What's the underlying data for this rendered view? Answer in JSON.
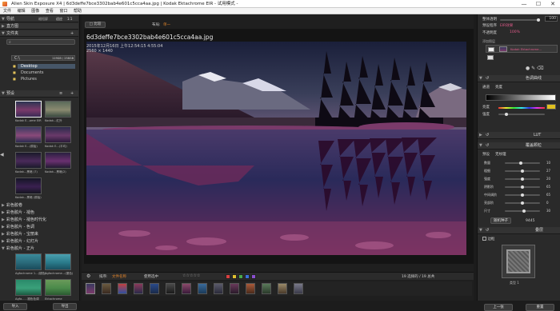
{
  "window": {
    "title": "Alien Skin Exposure X4 | 6d3deffe7bce3302bab4e601c5cca4aa.jpg | Kodak Ektachrome EIR - 试用模式 -",
    "minimize": "—",
    "maximize": "☐",
    "close": "✕"
  },
  "menu": [
    "文件",
    "编辑",
    "图像",
    "查看",
    "窗口",
    "帮助"
  ],
  "left": {
    "nav_label": "导航",
    "zoom_label": "缩短屏",
    "zoom_fit": "适应",
    "zoom_ratio": "1:1",
    "histogram_label": "直方图",
    "folders_label": "文件夹",
    "search_placeholder": "",
    "drive": "C:\\",
    "drive_size": "119GB / 238GB",
    "folders": [
      "Desktop",
      "Documents",
      "Pictures"
    ],
    "presets_label": "预设",
    "thumb_labels": [
      "Kodak E...ome EIR",
      "Kodak...红外",
      "Kodak E...(原始)",
      "Kodak E...(平均)",
      "Kodak...黑暗 (7)",
      "Kodak...黑暗(2)",
      "Kodak...黑暗 (原始)"
    ],
    "preset_groups": [
      "彩色胶卷",
      "彩色胶片 - 褪色",
      "彩色胶片 - 褪色时代化",
      "彩色胶片 - 色调",
      "彩色胶片 - 宝丽来",
      "彩色胶片 - 幻灯片",
      "彩色胶片 - 正片"
    ],
    "bottom_thumb_labels": [
      "Agfachrome 1...(褪色)",
      "Agfachrome...(褪色)",
      "Agfa... - 褪色色调",
      "Ektachrome"
    ],
    "import_button": "导入",
    "export_button": "导出"
  },
  "main": {
    "toolbar_view": "□ 比较",
    "toolbar_layout": "布局:",
    "layout_value": "单一",
    "filename": "6d3deffe7bce3302bab4e601c5cca4aa.jpg",
    "file_date": "2015年12月16日 上午12:54:15",
    "file_time": "4:55:04",
    "dimensions": "2560 × 1440",
    "bottom_sort_label": "排序:",
    "bottom_sort_value": "文件名称",
    "bottom_filter_label": "使用选中",
    "bottom_status": "19 选择的 / 19 总共",
    "colors": [
      "#d84040",
      "#e0c030",
      "#49a84a",
      "#3a6fd8",
      "#8a4fcf"
    ]
  },
  "right": {
    "opacity_label": "整体透明",
    "opacity_value": "100",
    "preset_label": "预设程序",
    "preset_value": "EIR效果",
    "layers_label": "不透明度",
    "layers_value": "100%",
    "add_layer": "添加图层",
    "layer_name": "Kodak Ektachrome...",
    "curves_label": "色调曲线",
    "channel_label": "通道",
    "channel_value": "亮度",
    "highlight_label": "亮度",
    "shadow_label": "强度",
    "lut_label": "LUT",
    "grain_label": "覆盖颗粒",
    "grain_preset_label": "预设",
    "grain_preset_value": "无纹理",
    "grain_rows": [
      "数量",
      "粗细",
      "强度",
      "阴影阶",
      "中间调阶",
      "亮部阶",
      "尺寸"
    ],
    "grain_values": [
      "10",
      "27",
      "20",
      "65",
      "65",
      "0",
      "30"
    ],
    "random_seed_button": "随机种子",
    "seed_value": "9445",
    "overlay_label": "叠层",
    "border_label": "边框",
    "border_sub": "类型 1",
    "prev_button": "上一张",
    "reset_button": "重置"
  }
}
